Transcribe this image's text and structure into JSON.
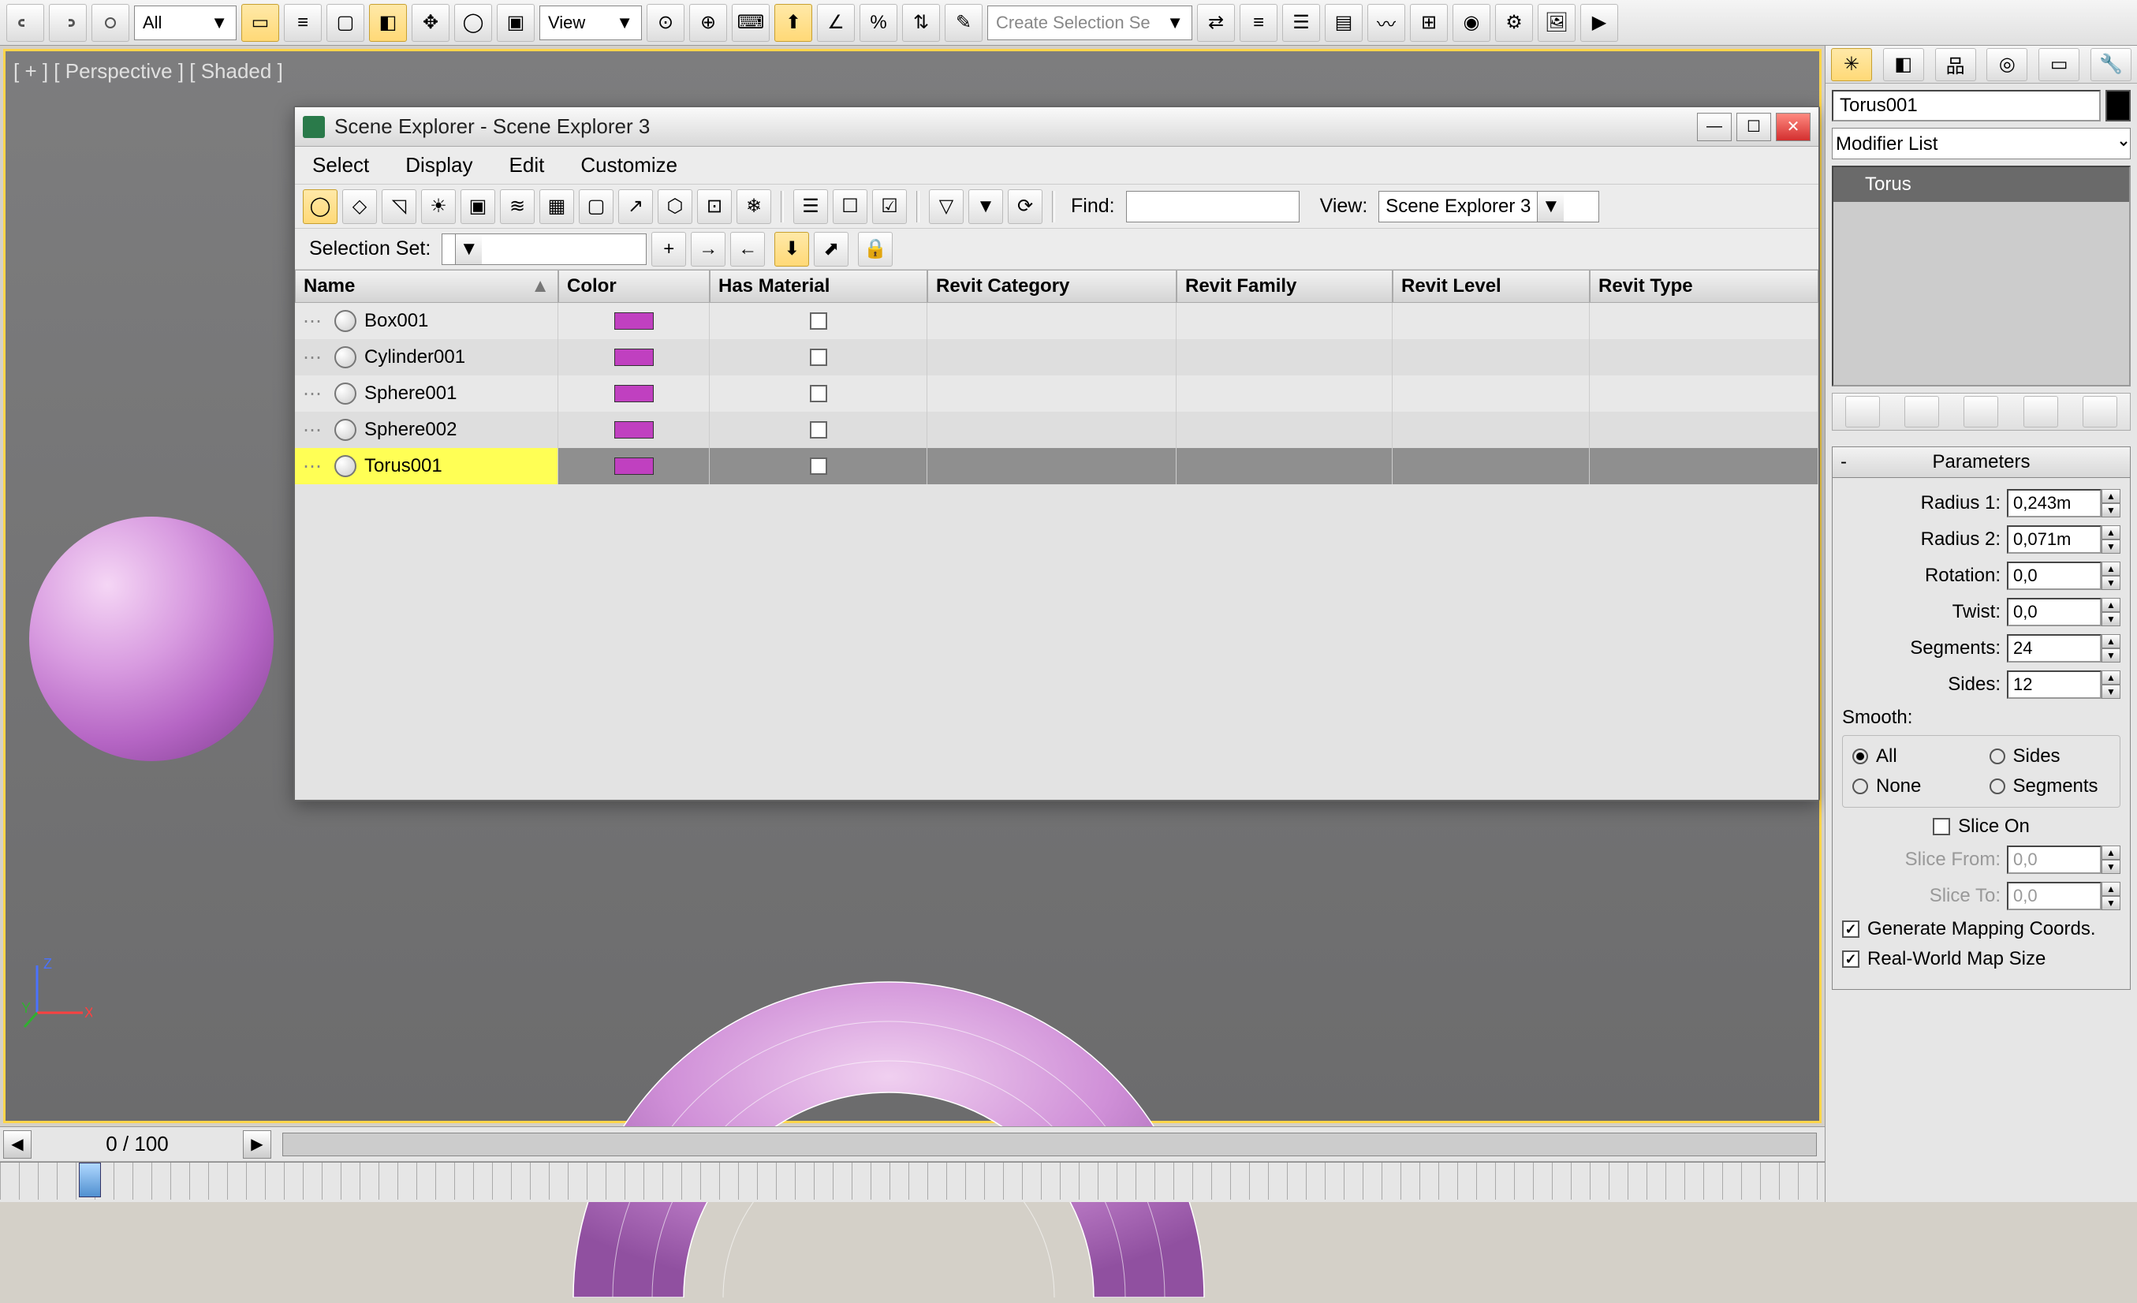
{
  "top_toolbar": {
    "filter_all": "All",
    "filter_view": "View",
    "selection_set_placeholder": "Create Selection Se"
  },
  "viewport": {
    "label": "[ + ] [ Perspective ] [ Shaded ]"
  },
  "scene_explorer": {
    "title": "Scene Explorer - Scene Explorer 3",
    "menus": [
      "Select",
      "Display",
      "Edit",
      "Customize"
    ],
    "find_label": "Find:",
    "view_label": "View:",
    "view_value": "Scene Explorer 3",
    "selection_set_label": "Selection Set:",
    "columns": [
      "Name",
      "Color",
      "Has Material",
      "Revit Category",
      "Revit Family",
      "Revit Level",
      "Revit Type"
    ],
    "rows": [
      {
        "name": "Box001",
        "color": "#c040c0",
        "has_material": false,
        "selected": false
      },
      {
        "name": "Cylinder001",
        "color": "#c040c0",
        "has_material": false,
        "selected": false
      },
      {
        "name": "Sphere001",
        "color": "#c040c0",
        "has_material": false,
        "selected": false
      },
      {
        "name": "Sphere002",
        "color": "#c040c0",
        "has_material": false,
        "selected": false
      },
      {
        "name": "Torus001",
        "color": "#c040c0",
        "has_material": false,
        "selected": true
      }
    ]
  },
  "right_panel": {
    "object_name": "Torus001",
    "modifier_list": "Modifier List",
    "stack_item": "Torus",
    "rollout_title": "Parameters",
    "params": {
      "radius1_label": "Radius 1:",
      "radius1_value": "0,243m",
      "radius2_label": "Radius 2:",
      "radius2_value": "0,071m",
      "rotation_label": "Rotation:",
      "rotation_value": "0,0",
      "twist_label": "Twist:",
      "twist_value": "0,0",
      "segments_label": "Segments:",
      "segments_value": "24",
      "sides_label": "Sides:",
      "sides_value": "12"
    },
    "smooth_label": "Smooth:",
    "smooth_options": {
      "all": "All",
      "sides": "Sides",
      "none": "None",
      "segments": "Segments"
    },
    "smooth_selected": "all",
    "slice_on_label": "Slice On",
    "slice_on": false,
    "slice_from_label": "Slice From:",
    "slice_from_value": "0,0",
    "slice_to_label": "Slice To:",
    "slice_to_value": "0,0",
    "gen_mapping_label": "Generate Mapping Coords.",
    "gen_mapping": true,
    "real_world_label": "Real-World Map Size",
    "real_world": true
  },
  "timeline": {
    "frame_display": "0 / 100"
  },
  "axis_labels": {
    "x": "X",
    "y": "Y",
    "z": "Z"
  }
}
